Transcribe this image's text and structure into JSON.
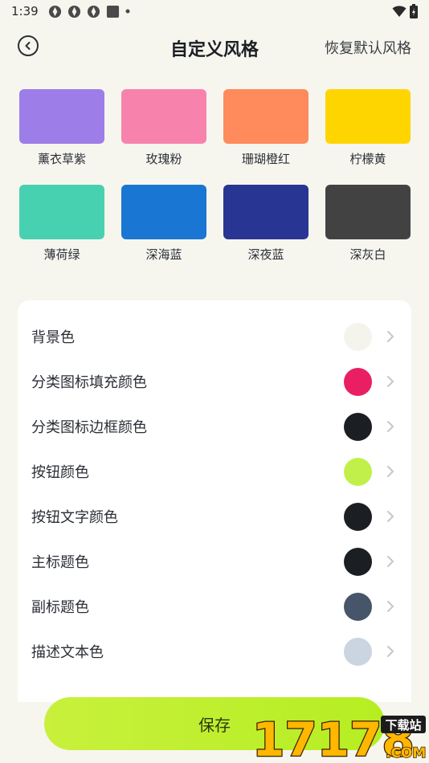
{
  "status_bar": {
    "time": "1:39"
  },
  "header": {
    "title": "自定义风格",
    "reset_label": "恢复默认风格"
  },
  "presets": [
    {
      "label": "薰衣草紫",
      "color": "#9d7de8"
    },
    {
      "label": "玫瑰粉",
      "color": "#f783ac"
    },
    {
      "label": "珊瑚橙红",
      "color": "#ff8a5c"
    },
    {
      "label": "柠檬黄",
      "color": "#ffd500"
    },
    {
      "label": "薄荷绿",
      "color": "#48d1b0"
    },
    {
      "label": "深海蓝",
      "color": "#1976d2"
    },
    {
      "label": "深夜蓝",
      "color": "#283593"
    },
    {
      "label": "深灰白",
      "color": "#424242"
    }
  ],
  "settings": [
    {
      "label": "背景色",
      "color": "#f4f4ec"
    },
    {
      "label": "分类图标填充颜色",
      "color": "#e91e63"
    },
    {
      "label": "分类图标边框颜色",
      "color": "#1b1f24"
    },
    {
      "label": "按钮颜色",
      "color": "#c2f04a"
    },
    {
      "label": "按钮文字颜色",
      "color": "#1b1f24"
    },
    {
      "label": "主标题色",
      "color": "#1b1f24"
    },
    {
      "label": "副标题色",
      "color": "#465569"
    },
    {
      "label": "描述文本色",
      "color": "#cbd5e1"
    }
  ],
  "save_label": "保存",
  "watermark": {
    "number": "17178",
    "tag": "下载站",
    "domain": ".COM"
  }
}
